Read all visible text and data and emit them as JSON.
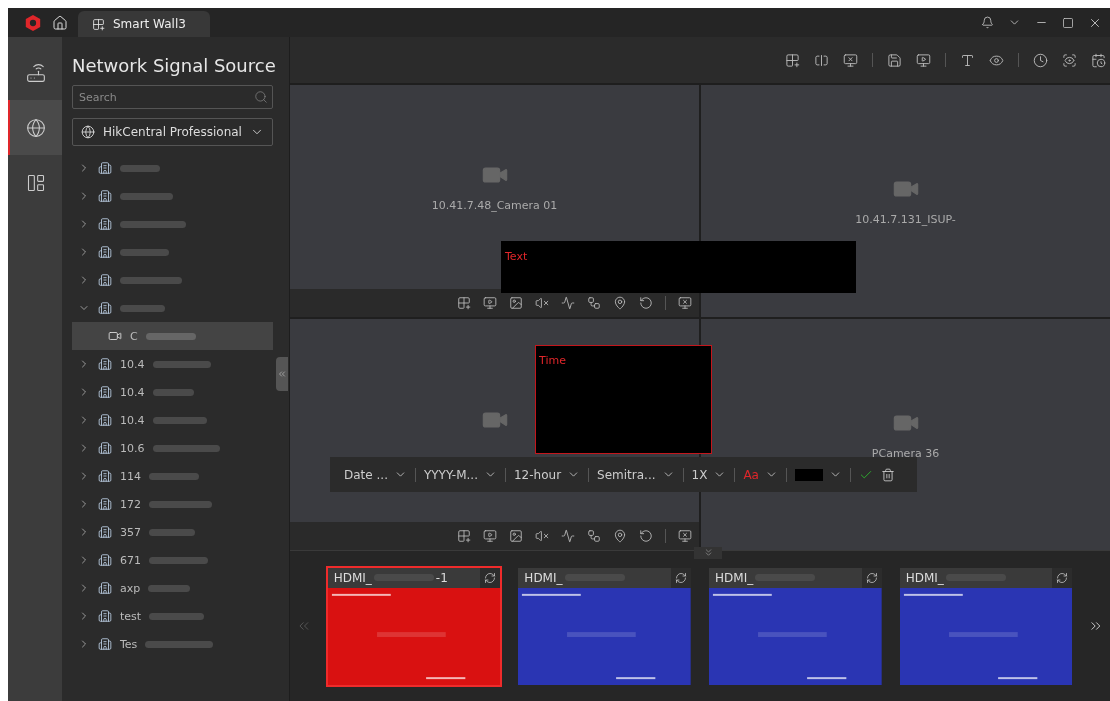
{
  "app": {
    "tabs": [
      {
        "label": "Smart Wall3",
        "selected": true
      }
    ]
  },
  "rail": [
    {
      "kind": "encoder",
      "selected": false
    },
    {
      "kind": "network",
      "selected": true
    },
    {
      "kind": "layout",
      "selected": false
    }
  ],
  "sidebar": {
    "title": "Network Signal Source",
    "search": {
      "placeholder": "Search"
    },
    "site": {
      "value": "HikCentral Professional"
    },
    "tree": [
      {
        "expanded": false,
        "selected": false
      },
      {
        "expanded": false,
        "selected": false
      },
      {
        "expanded": false,
        "selected": false
      },
      {
        "expanded": false,
        "selected": false
      },
      {
        "expanded": false,
        "selected": false
      },
      {
        "expanded": true,
        "selected": false,
        "children": [
          {
            "label": "C",
            "selected": true
          }
        ]
      },
      {
        "label": "10.4",
        "expanded": false,
        "selected": false
      },
      {
        "label": "10.4",
        "expanded": false,
        "selected": false
      },
      {
        "label": "10.4",
        "expanded": false,
        "selected": false
      },
      {
        "label": "10.6",
        "expanded": false,
        "selected": false
      },
      {
        "label": "114",
        "expanded": false,
        "selected": false
      },
      {
        "label": "172",
        "expanded": false,
        "selected": false
      },
      {
        "label": "357",
        "expanded": false,
        "selected": false
      },
      {
        "label": "671",
        "expanded": false,
        "selected": false
      },
      {
        "label": "axp",
        "expanded": false,
        "selected": false
      },
      {
        "label": "test",
        "expanded": false,
        "selected": false
      },
      {
        "label": "Tes",
        "expanded": false,
        "selected": false
      }
    ]
  },
  "wall": {
    "cells": [
      {
        "label": "10.41.7.48_Camera 01",
        "toolbar": true
      },
      {
        "label": "10.41.7.131_ISUP-",
        "toolbar": false
      },
      {
        "toolbar": true
      },
      {
        "label": "PCamera 36",
        "toolbar": false
      }
    ],
    "windows": [
      {
        "kind": "text",
        "label": "Text",
        "selected": false
      },
      {
        "kind": "time",
        "label": "Time",
        "selected": true
      }
    ],
    "format_bar": [
      {
        "kind": "select",
        "value": "Date ..."
      },
      {
        "kind": "select",
        "value": "YYYY-M..."
      },
      {
        "kind": "select",
        "value": "12-hour"
      },
      {
        "kind": "select",
        "value": "Semitra..."
      },
      {
        "kind": "select",
        "value": "1X"
      },
      {
        "kind": "font",
        "value": "Aa",
        "color": "#e0262a"
      },
      {
        "kind": "swatch",
        "color": "#000000"
      }
    ]
  },
  "outputs": [
    {
      "title": "HDMI_",
      "suffix": "-1",
      "color": "#d91111",
      "selected": true
    },
    {
      "title": "HDMI_",
      "color": "#2a35b3",
      "selected": false
    },
    {
      "title": "HDMI_",
      "color": "#2a35b3",
      "selected": false
    },
    {
      "title": "HDMI_",
      "color": "#2a35b3",
      "selected": false
    }
  ]
}
